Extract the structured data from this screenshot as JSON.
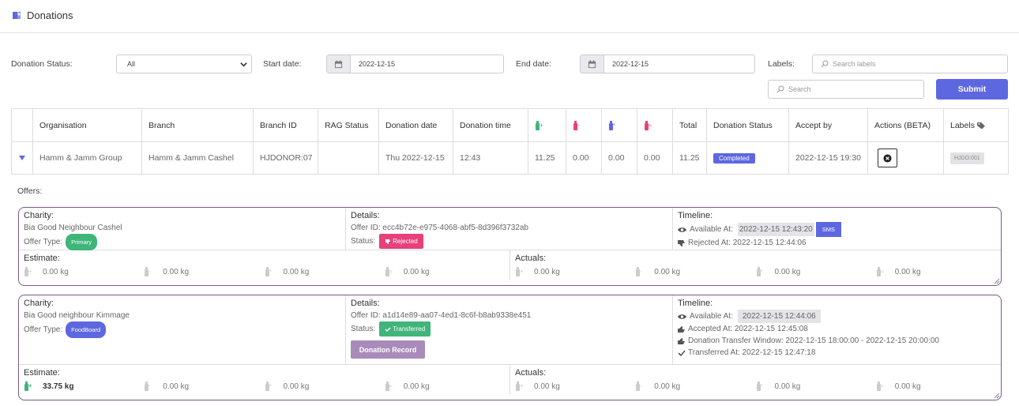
{
  "header": {
    "title": "Donations"
  },
  "filters": {
    "status_label": "Donation Status:",
    "status_value": "All",
    "start_label": "Start date:",
    "start_value": "2022-12-15",
    "end_label": "End date:",
    "end_value": "2022-12-15",
    "labels_label": "Labels:",
    "labels_placeholder": "Search labels",
    "search_placeholder": "Search",
    "submit_label": "Submit"
  },
  "table": {
    "headers": [
      "",
      "Organisation",
      "Branch",
      "Branch ID",
      "RAG Status",
      "Donation date",
      "Donation time",
      "",
      "",
      "",
      "",
      "Total",
      "Donation Status",
      "Accept by",
      "Actions (BETA)",
      "Labels"
    ],
    "row": {
      "organisation": "Hamm & Jamm Group",
      "branch": "Hamm & Jamm Cashel",
      "branch_id": "HJDONOR:07",
      "rag": "",
      "date": "Thu 2022-12-15",
      "time": "12:43",
      "w1": "11.25",
      "w2": "0.00",
      "w3": "0.00",
      "w4": "0.00",
      "total": "11.25",
      "status": "Completed",
      "accept_by": "2022-12-15 19:30",
      "label": "HJDO:001"
    }
  },
  "offers_label": "Offers:",
  "offers": [
    {
      "charity_h": "Charity:",
      "charity": "Bia Good Neighbour Cashel",
      "offer_type_label": "Offer Type:",
      "offer_type": "Primary",
      "details_h": "Details:",
      "offer_id": "Offer ID: ecc4b72e-e975-4068-abf5-8d396f3732ab",
      "status_label": "Status:",
      "status": "Rejected",
      "timeline_h": "Timeline:",
      "available_label": "Available At:",
      "available": "2022-12-15 12:43:20",
      "sms": "SMS",
      "rejected": "Rejected At:  2022-12-15 12:44:06",
      "estimate_h": "Estimate:",
      "estimates": [
        "0.00 kg",
        "0.00 kg",
        "0.00 kg",
        "0.00 kg"
      ],
      "actuals_h": "Actuals:",
      "actuals": [
        "0.00 kg",
        "0.00 kg",
        "0.00 kg",
        "0.00 kg"
      ]
    },
    {
      "charity_h": "Charity:",
      "charity": "Bia Good neighbour Kimmage",
      "offer_type_label": "Offer Type:",
      "offer_type": "FoodBoard",
      "details_h": "Details:",
      "offer_id": "Offer ID: a1d14e89-aa07-4ed1-8c6f-b8ab9338e451",
      "status_label": "Status:",
      "status": "Transferred",
      "record_button": "Donation Record",
      "timeline_h": "Timeline:",
      "available_label": "Available At:",
      "available": "2022-12-15 12:44:06",
      "accepted": "Accepted At:  2022-12-15 12:45:08",
      "window": "Donation Transfer Window:  2022-12-15 18:00:00 - 2022-12-15 20:00:00",
      "transferred": "Transferred At:  2022-12-15 12:47:18",
      "estimate_h": "Estimate:",
      "estimates": [
        "33.75 kg",
        "0.00 kg",
        "0.00 kg",
        "0.00 kg"
      ],
      "actuals_h": "Actuals:",
      "actuals": [
        "0.00 kg",
        "0.00 kg",
        "0.00 kg",
        "0.00 kg"
      ]
    }
  ],
  "colors": {
    "accent": "#5d67e0",
    "completed": "#5d67e0",
    "primary": "#3fb57a",
    "foodboard": "#5d67e0",
    "rejected": "#e8407a",
    "transferred": "#3fb57a",
    "record": "#a98bba"
  }
}
